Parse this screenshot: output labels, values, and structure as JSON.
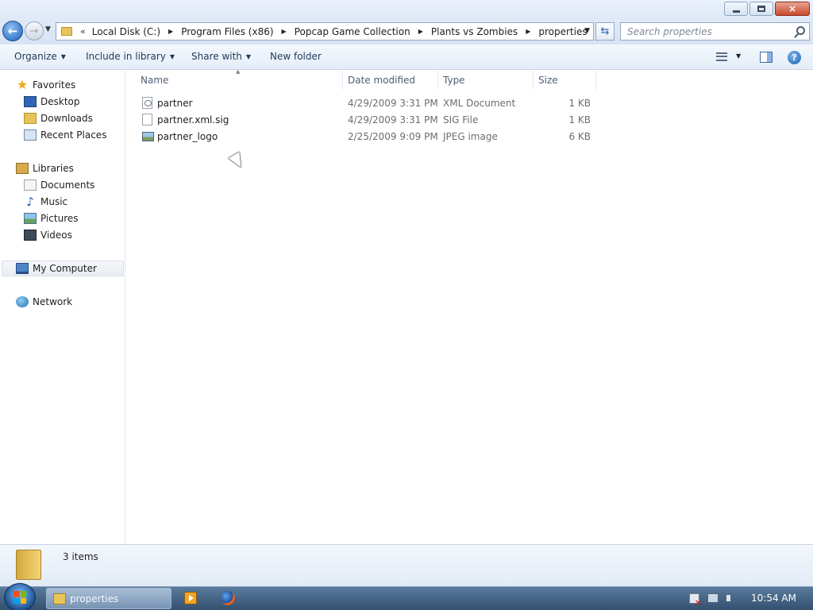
{
  "window": {
    "minimize_icon": "minimize-icon",
    "maximize_icon": "restore-icon",
    "close_label": "×"
  },
  "navigation": {
    "back_label": "←",
    "forward_label": "→"
  },
  "address": {
    "overflow_label": "«",
    "breadcrumbs": [
      "Local Disk (C:)",
      "Program Files (x86)",
      "Popcap Game Collection",
      "Plants vs Zombies",
      "properties"
    ]
  },
  "search": {
    "placeholder": "Search properties"
  },
  "toolbar": {
    "organize": "Organize",
    "include_in_library": "Include in library",
    "share_with": "Share with",
    "new_folder": "New folder",
    "help_label": "?"
  },
  "nav_pane": {
    "favorites": {
      "label": "Favorites",
      "items": [
        "Desktop",
        "Downloads",
        "Recent Places"
      ]
    },
    "libraries": {
      "label": "Libraries",
      "items": [
        "Documents",
        "Music",
        "Pictures",
        "Videos"
      ]
    },
    "computer": "My Computer",
    "network": "Network"
  },
  "file_list": {
    "columns": [
      "Name",
      "Date modified",
      "Type",
      "Size"
    ],
    "rows": [
      {
        "name": "partner",
        "date": "4/29/2009 3:31 PM",
        "type": "XML Document",
        "size": "1 KB"
      },
      {
        "name": "partner.xml.sig",
        "date": "4/29/2009 3:31 PM",
        "type": "SIG File",
        "size": "1 KB"
      },
      {
        "name": "partner_logo",
        "date": "2/25/2009 9:09 PM",
        "type": "JPEG image",
        "size": "6 KB"
      }
    ]
  },
  "details": {
    "item_count": "3 items"
  },
  "taskbar": {
    "active_window": "properties",
    "clock": "10:54 AM"
  },
  "colors": {
    "accent": "#2f66b7",
    "selection": "#e8ecf2",
    "taskbar": "#34506f"
  }
}
